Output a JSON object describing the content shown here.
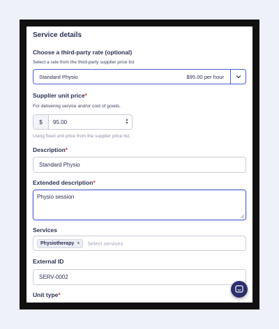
{
  "section": {
    "title": "Service details"
  },
  "rate": {
    "label": "Choose a third-party rate (optional)",
    "hint": "Select a rate from the third-party supplier price list",
    "selected_name": "Standard Physio",
    "selected_price": "$95.00 per hour"
  },
  "unit_price": {
    "label": "Supplier unit price",
    "required_mark": "*",
    "hint": "For delivering service and/or cost of goods.",
    "currency": "$",
    "value": "95.00",
    "note": "Using fixed unit price from the supplier price list."
  },
  "description": {
    "label": "Description",
    "required_mark": "*",
    "value": "Standard Physio"
  },
  "extended_description": {
    "label": "Extended description",
    "required_mark": "*",
    "value": "Physio session"
  },
  "services": {
    "label": "Services",
    "chips": [
      {
        "label": "Physiotherapy",
        "remove": "×"
      }
    ],
    "placeholder": "Select services"
  },
  "external_id": {
    "label": "External ID",
    "value": "SERV-0002"
  },
  "unit_type": {
    "label": "Unit type",
    "required_mark": "*"
  },
  "icons": {
    "chevron": "chevron-down-icon",
    "chat": "chat-icon"
  },
  "colors": {
    "accent": "#4a5bd4",
    "fab": "#2b2f6b",
    "required": "#d03a3a"
  }
}
